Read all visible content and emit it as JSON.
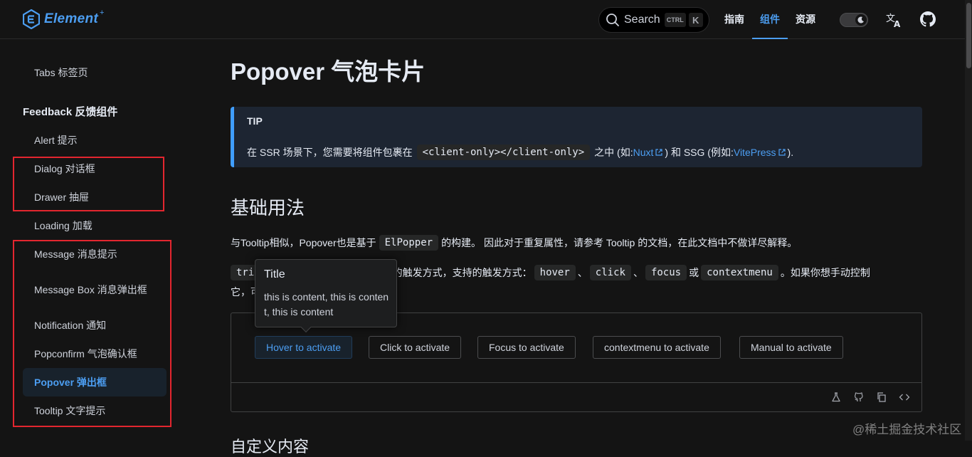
{
  "header": {
    "logo_text": "Element",
    "logo_sup": "+",
    "search_label": "Search",
    "search_kbd_ctrl": "CTRL",
    "search_kbd_key": "K",
    "nav": [
      "指南",
      "组件",
      "资源"
    ],
    "active_nav": "组件",
    "theme": "dark"
  },
  "sidebar": {
    "cut_item": "Tabs 标签页",
    "group_title": "Feedback 反馈组件",
    "items": [
      "Alert 提示",
      "Dialog 对话框",
      "Drawer 抽屉",
      "Loading 加载",
      "Message 消息提示",
      "Message Box 消息弹出框",
      "Notification 通知",
      "Popconfirm 气泡确认框",
      "Popover 弹出框",
      "Tooltip 文字提示"
    ],
    "active_item": "Popover 弹出框"
  },
  "main": {
    "title": "Popover 气泡卡片",
    "tip": {
      "title": "TIP",
      "text_before": "在 SSR 场景下，您需要将组件包裹在",
      "code": "<client-only></client-only>",
      "text_middle": "之中 (如: ",
      "link1": "Nuxt",
      "text_middle2": ") 和 SSG (例如: ",
      "link2": "VitePress",
      "text_after": ")."
    },
    "section_title": "基础用法",
    "para1_before": "与Tooltip相似，Popover也是基于",
    "para1_code": "ElPopper",
    "para1_after": "的构建。 因此对于重复属性，请参考 Tooltip 的文档，在此文档中不做详尽解释。",
    "para2_code_start": "tri",
    "para2_mid": "er 的触发方式，支持的触发方式：",
    "para2_codes": [
      "hover",
      "click",
      "focus",
      "contextmenu"
    ],
    "para2_sep": "、",
    "para2_or": "或",
    "para2_after": "。如果你想手动控制",
    "para2_line2": "它，可",
    "buttons": [
      "Hover to activate",
      "Click to activate",
      "Focus to activate",
      "contextmenu to activate",
      "Manual to activate"
    ],
    "popover": {
      "title": "Title",
      "content": "this is content, this is content, this is content"
    },
    "next_heading": "自定义内容"
  },
  "watermark": "@稀土掘金技术社区",
  "colors": {
    "accent": "#409eff",
    "highlight_box": "#e3262f",
    "background": "#141414"
  }
}
